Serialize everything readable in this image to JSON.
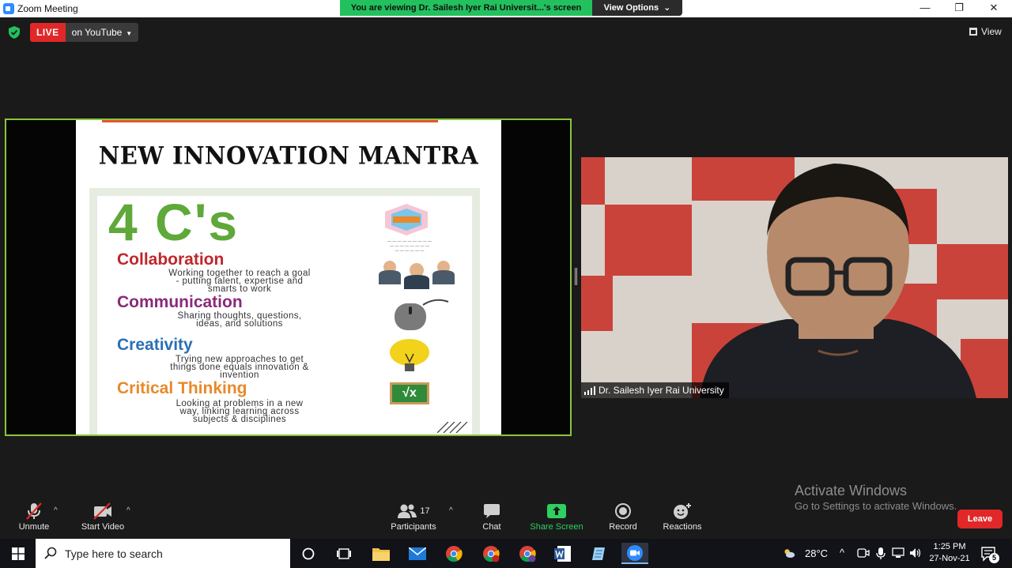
{
  "window": {
    "title": "Zoom Meeting",
    "minimize": "—",
    "restore": "❐",
    "close": "✕"
  },
  "share_banner": {
    "text": "You are viewing Dr. Sailesh Iyer Rai Universit...'s screen",
    "view_options_label": "View Options",
    "view_options_caret": "⌄"
  },
  "live": {
    "badge": "LIVE",
    "platform": "on YouTube",
    "caret": "▼"
  },
  "view_button": {
    "label": "View"
  },
  "slide": {
    "title": "NEW INNOVATION MANTRA",
    "heading": "4 C's",
    "items": [
      {
        "title": "Collaboration",
        "desc_1": "Working together to reach a goal",
        "desc_2": "- putting talent, expertise and",
        "desc_3": "smarts to work",
        "color": "#c0262b"
      },
      {
        "title": "Communication",
        "desc_1": "Sharing thoughts, questions,",
        "desc_2": "ideas, and solutions",
        "desc_3": "",
        "color": "#8a2a7a"
      },
      {
        "title": "Creativity",
        "desc_1": "Trying new approaches to get",
        "desc_2": "things done equals innovation &",
        "desc_3": "invention",
        "color": "#2a6fb5"
      },
      {
        "title": "Critical Thinking",
        "desc_1": "Looking at problems in a new",
        "desc_2": "way, linking learning across",
        "desc_3": "subjects & disciplines",
        "color": "#e8892a"
      }
    ],
    "board_symbol": "√x"
  },
  "participant": {
    "name": "Dr. Sailesh Iyer Rai University"
  },
  "watermark": {
    "line1": "Activate Windows",
    "line2": "Go to Settings to activate Windows."
  },
  "toolbar": {
    "unmute": "Unmute",
    "start_video": "Start Video",
    "participants": "Participants",
    "participants_count": "17",
    "chat": "Chat",
    "share_screen": "Share Screen",
    "record": "Record",
    "reactions": "Reactions",
    "leave": "Leave",
    "caret": "^"
  },
  "taskbar": {
    "search_placeholder": "Type here to search",
    "temperature": "28°C",
    "time": "1:25 PM",
    "date": "27-Nov-21",
    "notifications": "5",
    "tray_caret": "^"
  },
  "colors": {
    "accent_green": "#23c15e",
    "share_green": "#2ed061",
    "live_red": "#e02828",
    "frame_green": "#8ac53f"
  }
}
